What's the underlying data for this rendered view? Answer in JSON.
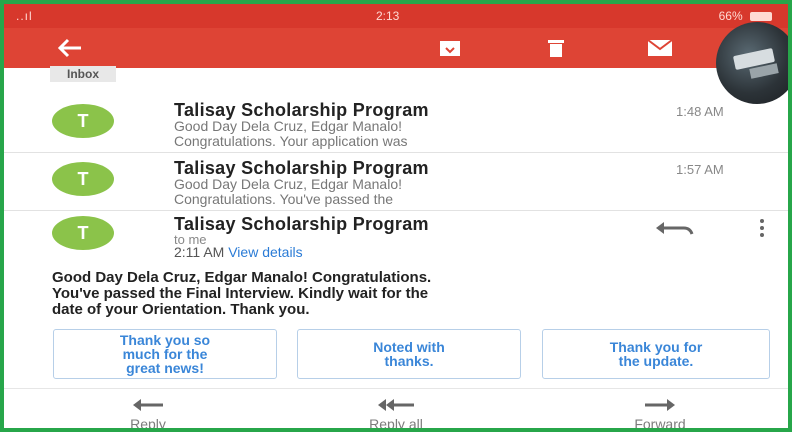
{
  "status_bar": {
    "signal": "..ıl",
    "time": "2:13",
    "battery": "66%"
  },
  "toolbar": {
    "icons": [
      "back-arrow-icon",
      "archive-icon",
      "trash-icon",
      "mail-icon"
    ]
  },
  "inbox_label": "Inbox",
  "messages": [
    {
      "avatar": "T",
      "sender": "Talisay Scholarship Program",
      "time": "1:48 AM",
      "line1": "Good Day Dela Cruz, Edgar Manalo!",
      "line2": "Congratulations. Your application was"
    },
    {
      "avatar": "T",
      "sender": "Talisay Scholarship Program",
      "time": "1:57 AM",
      "line1": "Good Day Dela Cruz, Edgar Manalo!",
      "line2": "Congratulations. You've passed the"
    }
  ],
  "open_message": {
    "avatar": "T",
    "sender": "Talisay Scholarship Program",
    "to": "to me",
    "time": "2:11 AM",
    "details_link": "View details",
    "body_line1": "Good Day Dela Cruz, Edgar Manalo! Congratulations.",
    "body_line2": "You've passed the Final Interview. Kindly wait for the",
    "body_line3": "date of your Orientation. Thank you."
  },
  "smart_replies": [
    {
      "l1": "Thank you so",
      "l2": "much for the",
      "l3": "great news!"
    },
    {
      "l1": "Noted with",
      "l2": "thanks."
    },
    {
      "l1": "Thank you for",
      "l2": "the update."
    }
  ],
  "actions": {
    "reply": "Reply",
    "reply_all": "Reply all",
    "forward": "Forward"
  },
  "colors": {
    "status_bar": "#d7382c",
    "toolbar": "#de4435",
    "avatar": "#8bc34a",
    "link": "#2a7bd6",
    "frame_border": "#27a64a"
  }
}
